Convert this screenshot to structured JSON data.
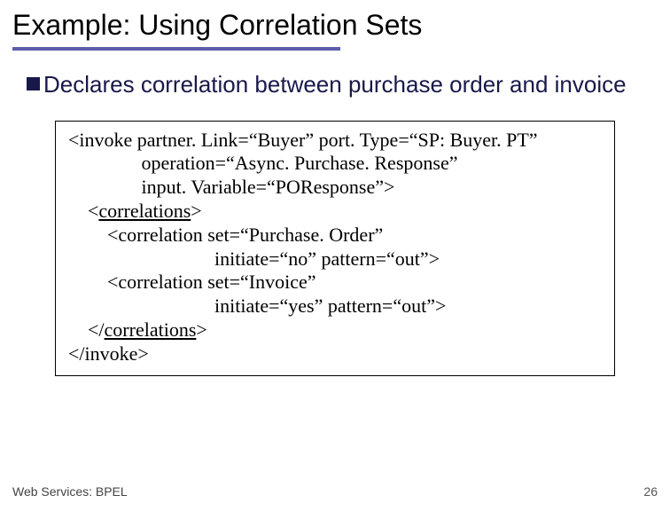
{
  "title": "Example: Using Correlation Sets",
  "bullet": "Declares correlation between purchase order and invoice",
  "code": {
    "l1": "<invoke partner. Link=“Buyer” port. Type=“SP: Buyer. PT”",
    "l2": "               operation=“Async. Purchase. Response”",
    "l3": "               input. Variable=“POResponse”>",
    "l4a": "    <",
    "l4b": "correlations",
    "l4c": ">",
    "l5": "        <correlation set=“Purchase. Order”",
    "l6": "                              initiate=“no” pattern=“out”>",
    "l7": "        <correlation set=“Invoice”",
    "l8": "                              initiate=“yes” pattern=“out”>",
    "l9a": "    </",
    "l9b": "correlations",
    "l9c": ">",
    "l10": "</invoke>"
  },
  "footer": {
    "left": "Web Services: BPEL",
    "right": "26"
  }
}
